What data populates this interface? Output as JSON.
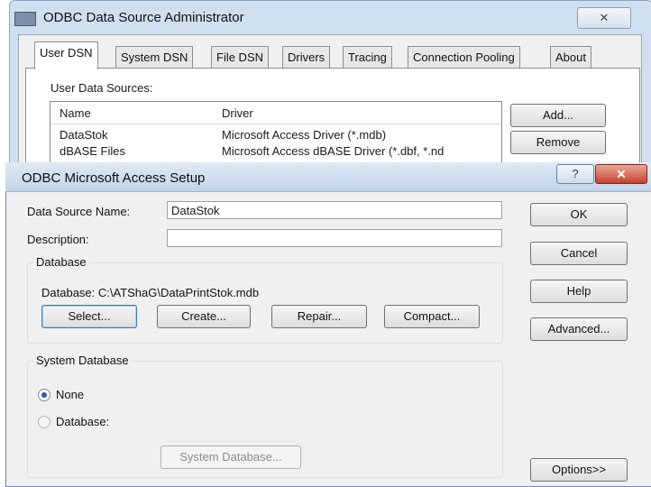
{
  "back_window": {
    "title": "ODBC Data Source Administrator",
    "close_glyph": "✕",
    "tabs": [
      "User DSN",
      "System DSN",
      "File DSN",
      "Drivers",
      "Tracing",
      "Connection Pooling",
      "About"
    ],
    "user_data_sources_label": "User Data Sources:",
    "columns": [
      "Name",
      "Driver"
    ],
    "rows": [
      {
        "name": "DataStok",
        "driver": "Microsoft Access Driver (*.mdb)"
      },
      {
        "name": "dBASE Files",
        "driver": "Microsoft Access dBASE Driver (*.dbf, *.nd"
      }
    ],
    "add_label": "Add...",
    "remove_label": "Remove"
  },
  "dialog": {
    "title": "ODBC Microsoft Access Setup",
    "help_glyph": "?",
    "close_glyph": "✕",
    "data_source_name_label": "Data Source Name:",
    "data_source_name_value": "DataStok",
    "description_label": "Description:",
    "description_value": "",
    "database_group_label": "Database",
    "database_path": "Database:  C:\\ATShaG\\DataPrintStok.mdb",
    "select_label": "Select...",
    "create_label": "Create...",
    "repair_label": "Repair...",
    "compact_label": "Compact...",
    "system_database_group_label": "System Database",
    "none_label": "None",
    "database_radio_label": "Database:",
    "system_database_button_label": "System Database...",
    "ok_label": "OK",
    "cancel_label": "Cancel",
    "help_label": "Help",
    "advanced_label": "Advanced...",
    "options_label": "Options>>"
  },
  "colors": {
    "title_gradient_top": "#dfe9f5",
    "close_red": "#c7442e",
    "radio_selected": "#1c5fa8"
  }
}
